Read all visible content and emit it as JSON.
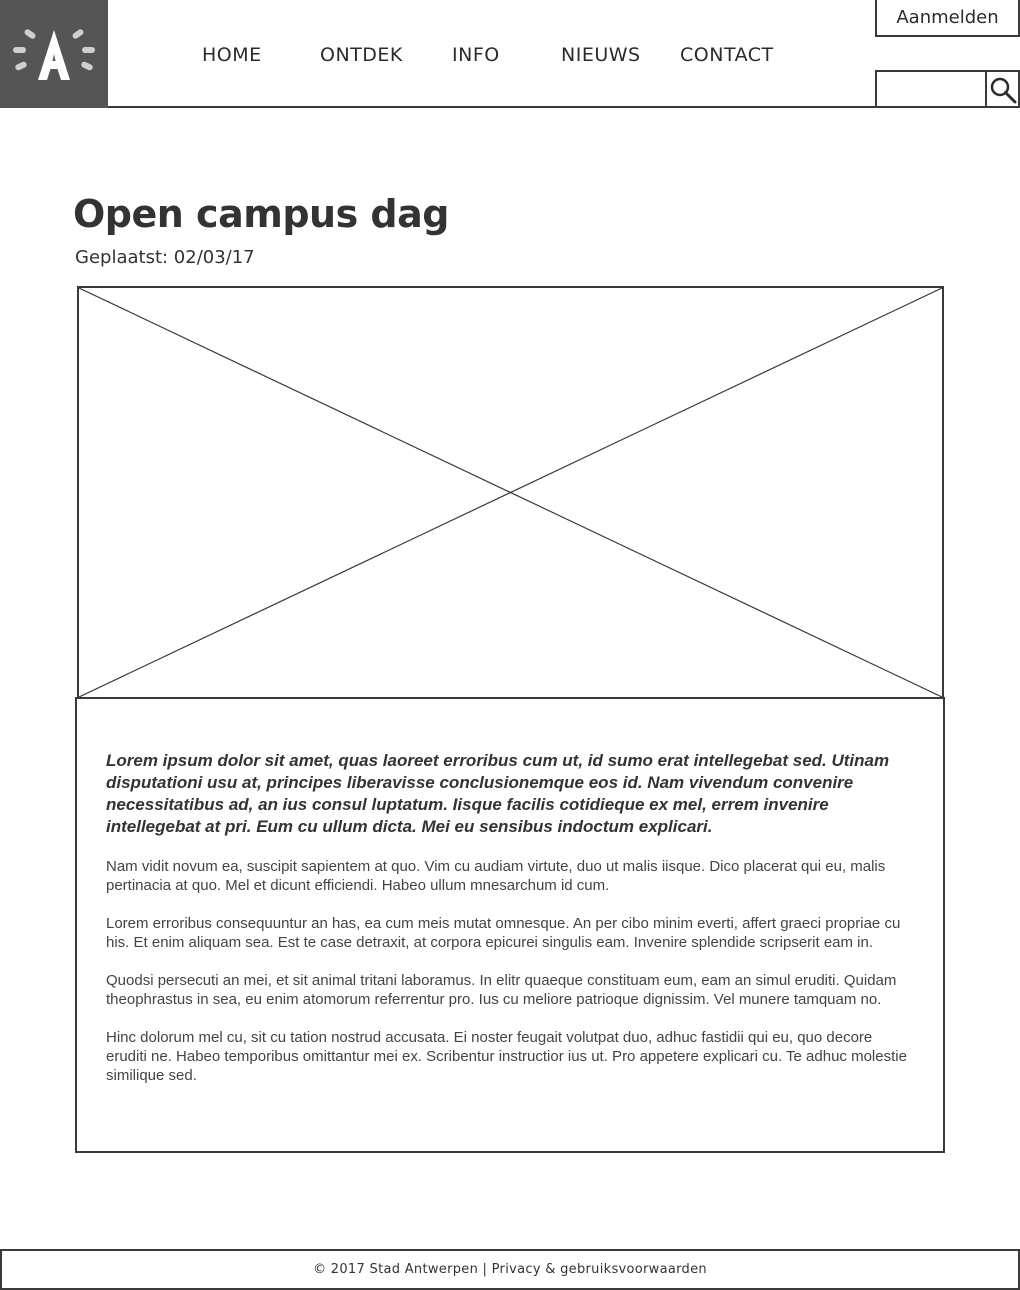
{
  "header": {
    "nav": [
      {
        "label": "HOME"
      },
      {
        "label": "ONTDEK"
      },
      {
        "label": "INFO"
      },
      {
        "label": "NIEUWS"
      },
      {
        "label": "CONTACT"
      }
    ],
    "login_label": "Aanmelden",
    "search_placeholder": "",
    "logo_icon": "antwerp-a-logo",
    "search_icon": "magnifier-icon"
  },
  "article": {
    "title": "Open campus dag",
    "posted": "Geplaatst: 02/03/17",
    "image_icon": "image-placeholder",
    "lead": "Lorem ipsum dolor sit amet, quas laoreet erroribus cum ut, id sumo erat intellegebat sed. Utinam disputationi usu at, principes liberavisse conclusionemque eos id. Nam vivendum convenire necessitatibus ad, an ius consul luptatum. Iisque facilis cotidieque ex mel, errem invenire intellegebat at pri. Eum cu ullum dicta. Mei eu sensibus indoctum explicari.",
    "paragraphs": [
      "Nam vidit novum ea, suscipit sapientem at quo. Vim cu audiam virtute, duo ut malis iisque. Dico placerat qui eu, malis pertinacia at quo. Mel et dicunt efficiendi. Habeo ullum mnesarchum id cum.",
      "Lorem erroribus consequuntur an has, ea cum meis mutat omnesque. An per cibo minim everti, affert graeci propriae cu his. Et enim aliquam sea. Est te case detraxit, at corpora epicurei singulis eam. Invenire splendide scripserit eam in.",
      "Quodsi persecuti an mei, et sit animal tritani laboramus. In elitr quaeque constituam eum, eam an simul eruditi. Quidam theophrastus in sea, eu enim atomorum referrentur pro. Ius cu meliore patrioque dignissim. Vel munere tamquam no.",
      "Hinc dolorum mel cu, sit cu tation nostrud accusata. Ei noster feugait volutpat duo, adhuc fastidii qui eu, quo decore eruditi ne. Habeo temporibus omittantur mei ex. Scribentur instructior ius ut. Pro appetere explicari cu. Te adhuc molestie similique sed."
    ]
  },
  "footer": {
    "text": "© 2017 Stad Antwerpen | Privacy & gebruiksvoorwaarden"
  },
  "colors": {
    "logo_bg": "#555555",
    "border": "#3a3a3a",
    "text": "#333333"
  }
}
